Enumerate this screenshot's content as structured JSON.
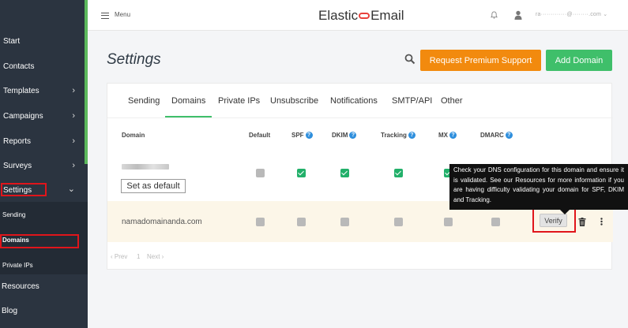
{
  "sidebar": {
    "items": [
      {
        "label": "Start",
        "chevron": false
      },
      {
        "label": "Contacts",
        "chevron": false
      },
      {
        "label": "Templates",
        "chevron": true
      },
      {
        "label": "Campaigns",
        "chevron": true
      },
      {
        "label": "Reports",
        "chevron": true
      },
      {
        "label": "Surveys",
        "chevron": true
      },
      {
        "label": "Settings",
        "chevron": true
      }
    ],
    "chevron_right": "›",
    "chevron_down": "⌄",
    "sub_items": [
      "Sending",
      "Domains",
      "Private IPs"
    ],
    "bottom_items": [
      "Resources",
      "Blog"
    ]
  },
  "topbar": {
    "menu_label": "Menu",
    "logo_left": "Elastic",
    "logo_right": "Email",
    "email_blurred": "ra·············@········.com ⌄"
  },
  "page": {
    "title": "Settings",
    "premium_button": "Request Premium Support",
    "add_domain_button": "Add Domain"
  },
  "tabs": [
    "Sending",
    "Domains",
    "Private IPs",
    "Unsubscribe",
    "Notifications",
    "SMTP/API",
    "Other"
  ],
  "table": {
    "headers": [
      "Domain",
      "Default",
      "SPF",
      "DKIM",
      "Tracking",
      "MX",
      "DMARC"
    ],
    "help_glyph": "?",
    "rows": [
      {
        "domain": "",
        "set_default_label": "Set as default",
        "checks": [
          "grey",
          "green",
          "green",
          "green",
          "green"
        ]
      },
      {
        "domain": "namadomainanda.com",
        "verify_label": "Verify",
        "checks": [
          "grey",
          "grey",
          "grey",
          "grey",
          "grey",
          "grey"
        ]
      }
    ],
    "pager_prev": "‹ Prev",
    "pager_page": "1",
    "pager_next": "Next ›"
  },
  "tooltip": {
    "text": "Check your DNS configuration for this domain and ensure it is validated. See our Resources for more information if you are having difficulty validating your domain for SPF, DKIM and Tracking."
  },
  "colors": {
    "sidebar_bg": "#2b3440",
    "accent_green": "#3fbf6a",
    "accent_orange": "#f28a0e",
    "highlight_row": "#fcf6e8",
    "help_blue": "#2f8fdd",
    "annotation_red": "#e0151b"
  }
}
